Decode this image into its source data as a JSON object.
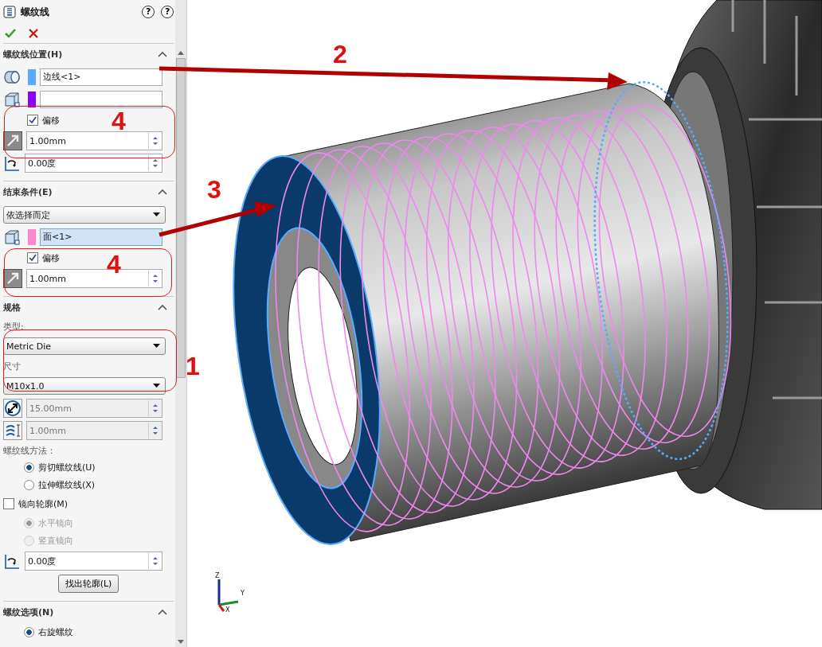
{
  "panel": {
    "title": "螺纹线",
    "help": [
      "?",
      "?"
    ],
    "sections": [
      {
        "title": "螺纹线位置(H)",
        "expanded": true,
        "rows": [
          {
            "kind": "edge",
            "color": "#5aaaff",
            "value": "边线<1>",
            "selected": false
          },
          {
            "kind": "face",
            "color": "#8a00ff",
            "selected": false
          },
          {
            "kind": "checkbox",
            "label": "偏移",
            "checked": true
          },
          {
            "kind": "offset",
            "value": "1.00mm",
            "disabled": false
          },
          {
            "kind": "angle",
            "value": "0.00度",
            "disabled": false
          }
        ]
      },
      {
        "title": "结束条件(E)",
        "expanded": true,
        "rows": [
          {
            "kind": "dropdown",
            "value": "依选择而定"
          },
          {
            "kind": "face",
            "color": "#ff88cc",
            "value": "面<1>",
            "selected": true
          },
          {
            "kind": "checkbox",
            "label": "偏移",
            "checked": true
          },
          {
            "kind": "offset",
            "value": "1.00mm",
            "disabled": false
          }
        ]
      },
      {
        "title": "规格",
        "expanded": true,
        "rows": [
          {
            "kind": "label",
            "label": "类型:"
          },
          {
            "kind": "dropdown",
            "value": "Metric Die"
          },
          {
            "kind": "label",
            "label": "尺寸"
          },
          {
            "kind": "dropdown",
            "value": "M10x1.0"
          },
          {
            "kind": "diameter",
            "value": "15.00mm",
            "disabled": true
          },
          {
            "kind": "pitch",
            "value": "1.00mm",
            "disabled": true
          },
          {
            "kind": "label",
            "label": "螺纹线方法："
          },
          {
            "kind": "radio",
            "label": "剪切螺纹线(U)",
            "selected": true,
            "disabled": false
          },
          {
            "kind": "radio",
            "label": "拉伸螺纹线(X)",
            "selected": false,
            "disabled": false
          },
          {
            "kind": "checkbox",
            "label": "镜向轮廓(M)",
            "checked": false
          },
          {
            "kind": "radio",
            "label": "水平镜向",
            "selected": true,
            "disabled": true
          },
          {
            "kind": "radio",
            "label": "竖直镜向",
            "selected": false,
            "disabled": true
          },
          {
            "kind": "angle",
            "value": "0.00度",
            "disabled": false
          },
          {
            "kind": "button",
            "label": "找出轮廓(L)"
          }
        ]
      },
      {
        "title": "螺纹选项(N)",
        "expanded": true,
        "rows": [
          {
            "kind": "radio",
            "label": "右旋螺纹",
            "selected": true,
            "disabled": false
          }
        ]
      }
    ]
  },
  "callouts": [
    {
      "label": "2"
    },
    {
      "label": "3"
    },
    {
      "label": "4"
    },
    {
      "label": "4"
    },
    {
      "label": "1"
    }
  ],
  "triad": [
    {
      "label": "Z"
    },
    {
      "label": "Y"
    },
    {
      "label": "X"
    }
  ]
}
